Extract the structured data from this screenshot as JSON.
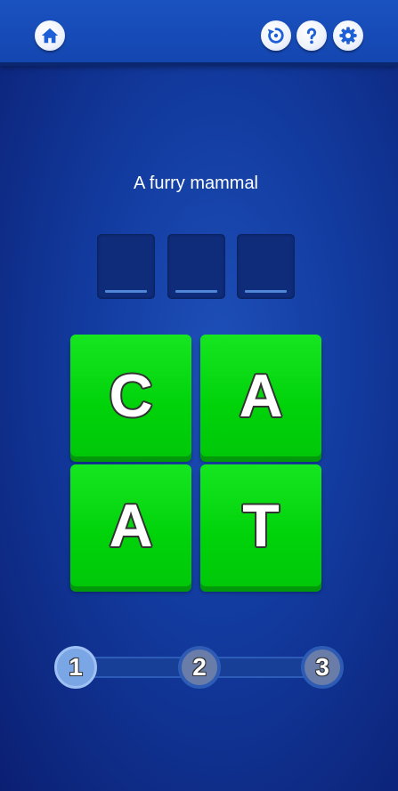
{
  "clue": "A furry mammal",
  "answer_slots": [
    "",
    "",
    ""
  ],
  "tiles": [
    {
      "letter": "C"
    },
    {
      "letter": "A"
    },
    {
      "letter": "A"
    },
    {
      "letter": "T"
    }
  ],
  "progress": {
    "steps": [
      "1",
      "2",
      "3"
    ],
    "current_step": 1
  },
  "toolbar": {
    "left": [
      "home-icon"
    ],
    "right": [
      "restart-icon",
      "help-icon",
      "settings-icon"
    ]
  },
  "colors": {
    "background": "#123a9e",
    "tile": "#00d20a",
    "slot": "#0f2c7a",
    "icon": "#1d5fd6"
  }
}
